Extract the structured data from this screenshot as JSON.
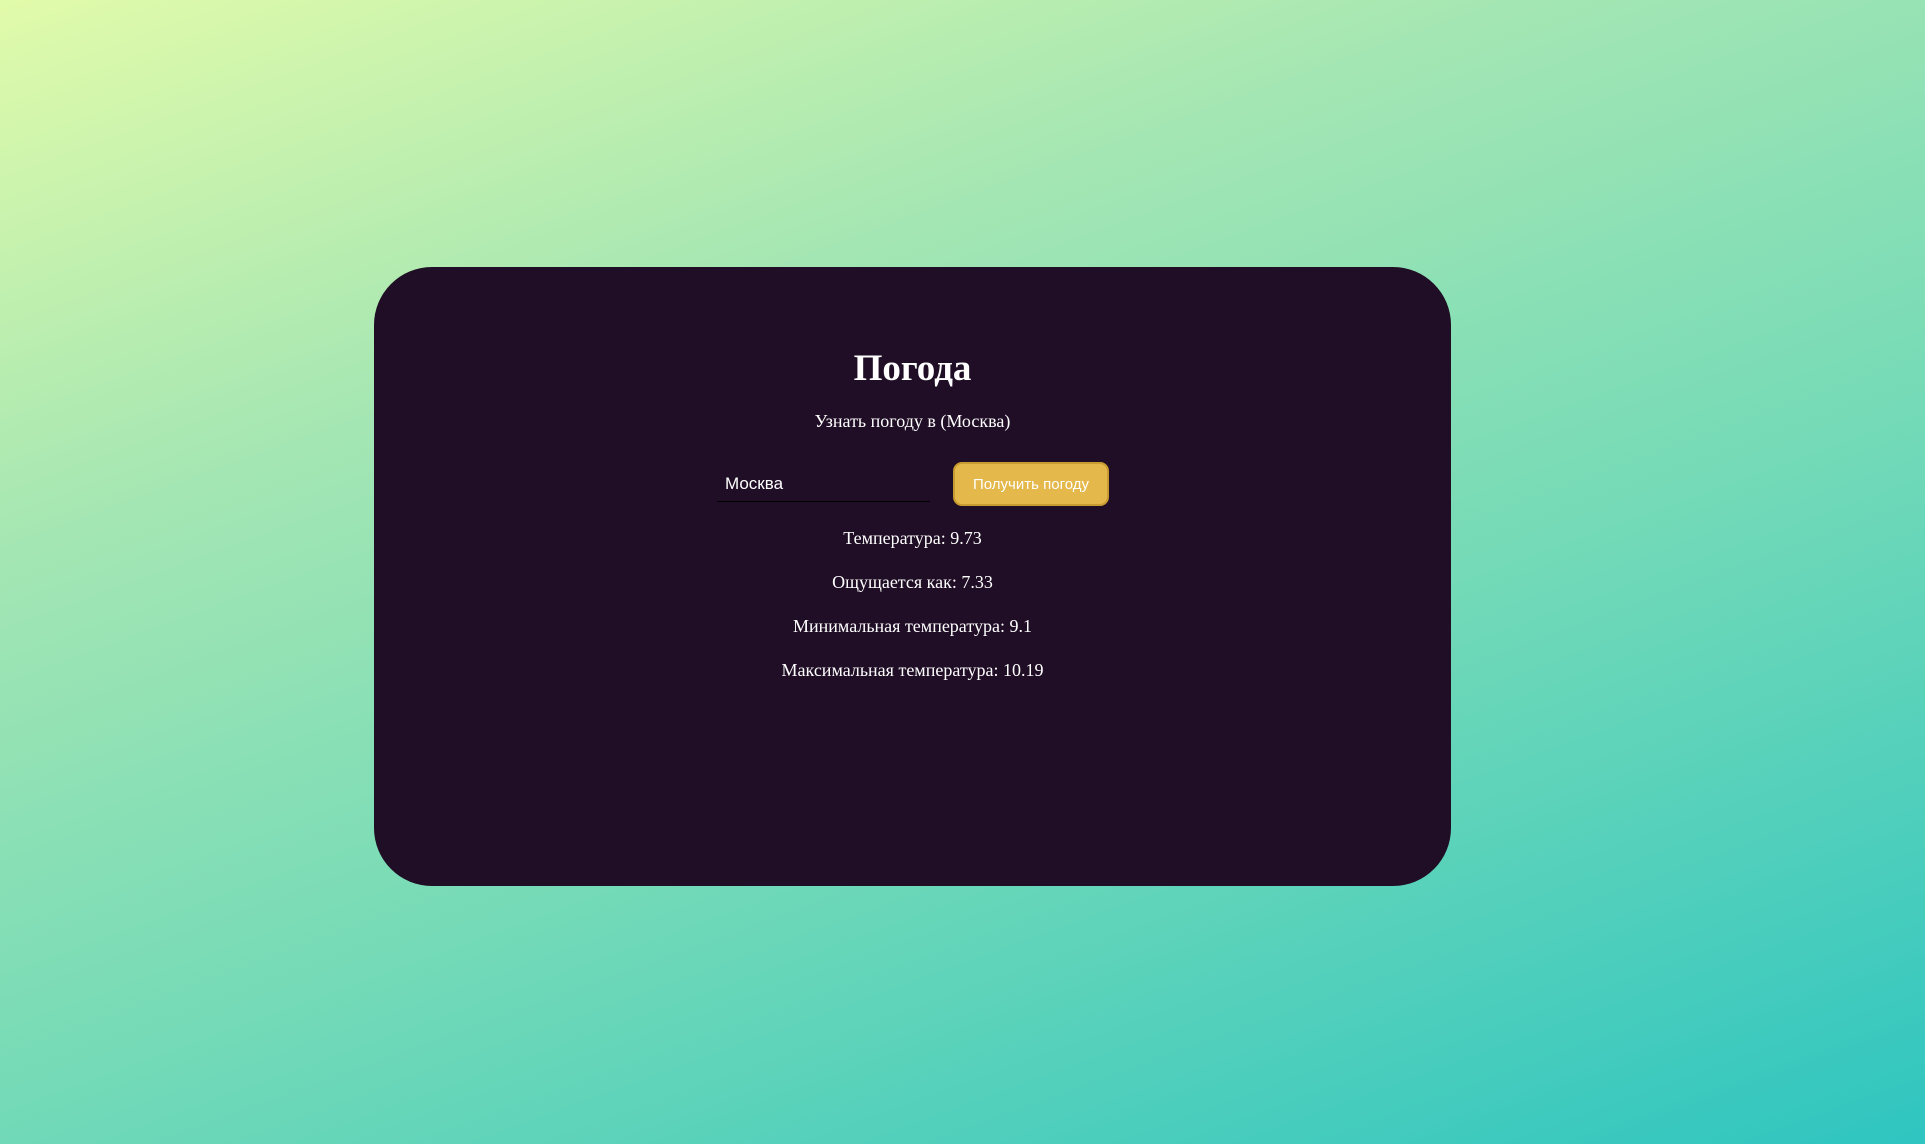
{
  "card": {
    "title": "Погода",
    "subtitle": "Узнать погоду в (Москва)",
    "city_input": {
      "value": "Москва",
      "placeholder": ""
    },
    "get_button_label": "Получить погоду",
    "results": {
      "temperature": "Температура: 9.73",
      "feels_like": "Ощущается как: 7.33",
      "temp_min": "Минимальная температура: 9.1",
      "temp_max": "Максимальная температура: 10.19"
    }
  },
  "colors": {
    "card_background": "#1f0e25",
    "button_background": "#e4b84b",
    "gradient_start": "#e1fbaa",
    "gradient_end": "#2fc5c0"
  }
}
